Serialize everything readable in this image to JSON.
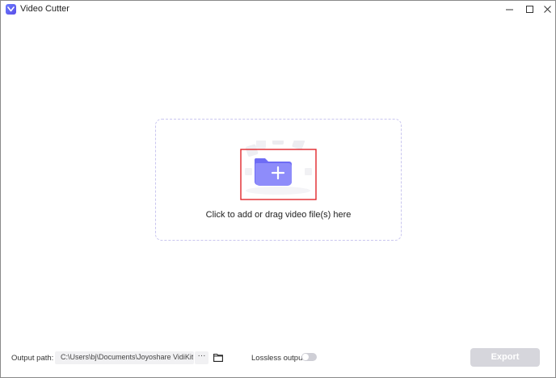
{
  "window": {
    "title": "Video Cutter"
  },
  "drop_zone": {
    "hint": "Click to add or drag video file(s) here"
  },
  "footer": {
    "output_path_label": "Output path:",
    "output_path_value": "C:\\Users\\bj\\Documents\\Joyoshare VidiKit\\Vid",
    "more_button_label": "···",
    "lossless_label": "Lossless output:",
    "lossless_enabled": false,
    "export_label": "Export"
  },
  "colors": {
    "accent": "#6b6cf5",
    "highlight_box": "#e0262b",
    "export_disabled": "#d6d6dc"
  }
}
